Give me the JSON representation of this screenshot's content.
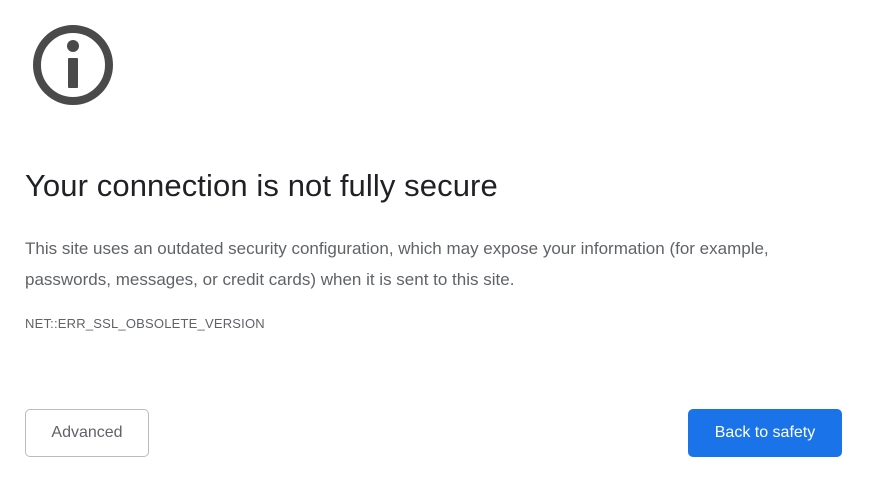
{
  "icon": {
    "name": "info-icon",
    "color": "#4a4a4a"
  },
  "heading": "Your connection is not fully secure",
  "description": "This site uses an outdated security configuration, which may expose your information (for example, passwords, messages, or credit cards) when it is sent to this site.",
  "error_code": "NET::ERR_SSL_OBSOLETE_VERSION",
  "buttons": {
    "advanced_label": "Advanced",
    "back_to_safety_label": "Back to safety"
  },
  "colors": {
    "primary_button": "#1a73e8",
    "text_primary": "#202124",
    "text_secondary": "#5f6368"
  }
}
